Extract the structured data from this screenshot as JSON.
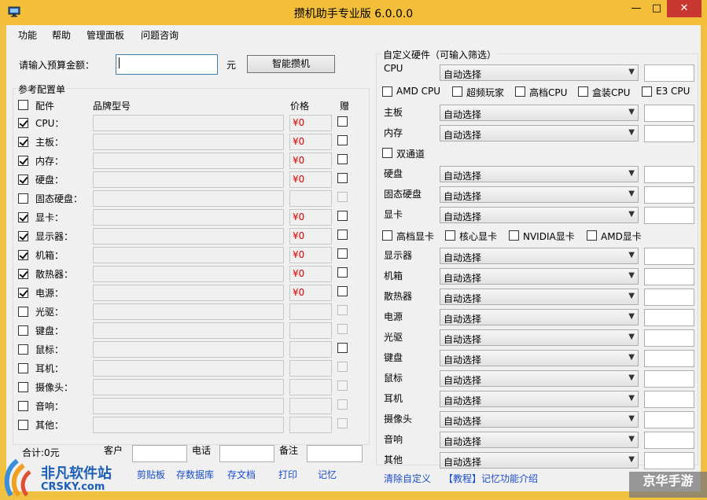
{
  "window": {
    "title": "攒机助手专业版 6.0.0.0",
    "minimize": "—",
    "maximize": "□",
    "close": "✕"
  },
  "menu": [
    "功能",
    "帮助",
    "管理面板",
    "问题咨询"
  ],
  "budget": {
    "label": "请输入预算金额：",
    "unit": "元",
    "button": "智能攒机",
    "value": ""
  },
  "config": {
    "group_title": "参考配置单",
    "header": {
      "part": "配件",
      "brand": "品牌型号",
      "price": "价格",
      "gift": "赠"
    },
    "rows": [
      {
        "label": "CPU：",
        "checked": true,
        "price": "¥0",
        "gift_enabled": true
      },
      {
        "label": "主板：",
        "checked": true,
        "price": "¥0",
        "gift_enabled": true
      },
      {
        "label": "内存：",
        "checked": true,
        "price": "¥0",
        "gift_enabled": true
      },
      {
        "label": "硬盘：",
        "checked": true,
        "price": "¥0",
        "gift_enabled": true
      },
      {
        "label": "固态硬盘：",
        "checked": false,
        "price": "",
        "gift_enabled": false
      },
      {
        "label": "显卡：",
        "checked": true,
        "price": "¥0",
        "gift_enabled": true
      },
      {
        "label": "显示器：",
        "checked": true,
        "price": "¥0",
        "gift_enabled": true
      },
      {
        "label": "机箱：",
        "checked": true,
        "price": "¥0",
        "gift_enabled": true
      },
      {
        "label": "散热器：",
        "checked": true,
        "price": "¥0",
        "gift_enabled": true
      },
      {
        "label": "电源：",
        "checked": true,
        "price": "¥0",
        "gift_enabled": true
      },
      {
        "label": "光驱：",
        "checked": false,
        "price": "",
        "gift_enabled": false
      },
      {
        "label": "键盘：",
        "checked": false,
        "price": "",
        "gift_enabled": false
      },
      {
        "label": "鼠标：",
        "checked": false,
        "price": "",
        "gift_enabled": true
      },
      {
        "label": "耳机：",
        "checked": false,
        "price": "",
        "gift_enabled": false
      },
      {
        "label": "摄像头：",
        "checked": false,
        "price": "",
        "gift_enabled": false
      },
      {
        "label": "音响：",
        "checked": false,
        "price": "",
        "gift_enabled": false
      },
      {
        "label": "其他：",
        "checked": false,
        "price": "",
        "gift_enabled": false
      }
    ]
  },
  "footer": {
    "total": "合计:0元",
    "customer_label": "客户",
    "phone_label": "电话",
    "note_label": "备注",
    "actions": [
      "剪贴板",
      "存数据库",
      "存文档",
      "打印",
      "记忆"
    ]
  },
  "hardware": {
    "group_title": "自定义硬件（可输入筛选）",
    "default_option": "自动选择",
    "cpu_label": "CPU",
    "cpu_filters": [
      "AMD CPU",
      "超频玩家",
      "高档CPU",
      "盒装CPU",
      "E3 CPU"
    ],
    "mid_rows": [
      "主板",
      "内存"
    ],
    "dual_channel": "双通道",
    "disk_rows": [
      "硬盘",
      "固态硬盘",
      "显卡"
    ],
    "gpu_filters": [
      "高档显卡",
      "核心显卡",
      "NVIDIA显卡",
      "AMD显卡"
    ],
    "lower_rows": [
      "显示器",
      "机箱",
      "散热器",
      "电源",
      "光驱",
      "键盘",
      "鼠标",
      "耳机",
      "摄像头",
      "音响",
      "其他"
    ],
    "links": [
      "清除自定义",
      "【教程】记忆功能介绍"
    ]
  },
  "watermarks": {
    "left_cn": "非凡软件站",
    "left_en": "CRSKY.com",
    "right": "京华手游"
  }
}
